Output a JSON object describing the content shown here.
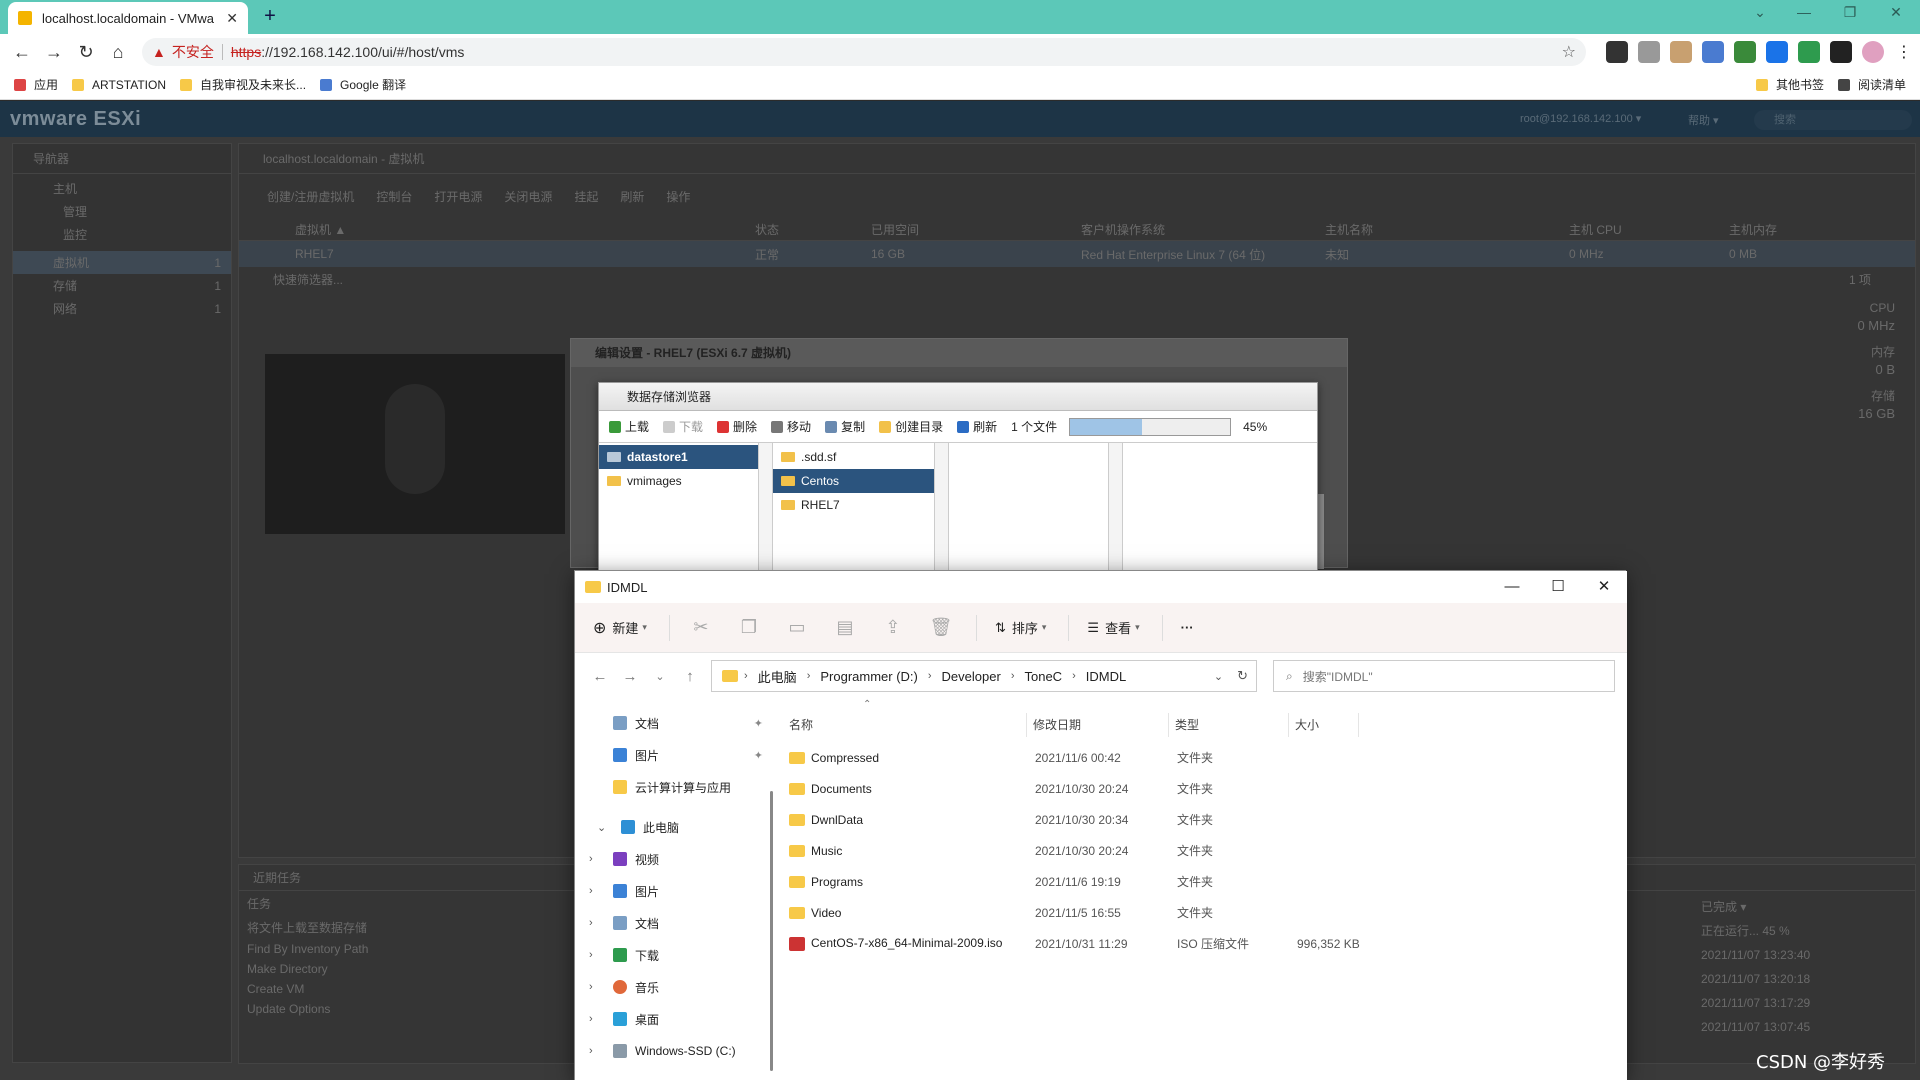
{
  "browser": {
    "tab_title": "localhost.localdomain - VMwa",
    "url_warning": "不安全",
    "url_scheme": "https",
    "url_rest": "://192.168.142.100/ui/#/host/vms",
    "bookmarks": [
      "应用",
      "ARTSTATION",
      "自我审视及未来长...",
      "Google 翻译"
    ],
    "bookmarks_right": [
      "其他书签",
      "阅读清单"
    ]
  },
  "esxi": {
    "logo": "vmware ESXi",
    "user": "root@192.168.142.100 ▾",
    "help": "帮助 ▾",
    "search_placeholder": "搜索",
    "navigator_title": "导航器",
    "nav_items": [
      "主机",
      "管理",
      "监控",
      "虚拟机",
      "存储",
      "网络"
    ],
    "nav_counts": [
      "1",
      "1",
      "1"
    ],
    "breadcrumb": "localhost.localdomain - 虚拟机",
    "actions": [
      "创建/注册虚拟机",
      "控制台",
      "打开电源",
      "关闭电源",
      "挂起",
      "刷新",
      "操作"
    ],
    "columns": [
      "虚拟机 ▲",
      "状态",
      "已用空间",
      "客户机操作系统",
      "主机名称",
      "主机 CPU",
      "主机内存"
    ],
    "row": [
      "RHEL7",
      "正常",
      "16 GB",
      "Red Hat Enterprise Linux 7 (64 位)",
      "未知",
      "0 MHz",
      "0 MB"
    ],
    "filter_placeholder": "快速筛选器...",
    "count": "1 项",
    "side_stats": [
      {
        "label": "CPU",
        "value": "0 MHz"
      },
      {
        "label": "内存",
        "value": "0 B"
      },
      {
        "label": "存储",
        "value": "16 GB"
      }
    ],
    "recent_tasks_title": "近期任务",
    "tasks_header": "任务",
    "tasks": [
      "将文件上载至数据存储",
      "Find By Inventory Path",
      "Make Directory",
      "Create VM",
      "Update Options"
    ],
    "tasks_completed_header": "已完成 ▾",
    "tasks_status": [
      "正在运行... 45 %",
      "2021/11/07 13:23:40",
      "2021/11/07 13:20:18",
      "2021/11/07 13:17:29",
      "2021/11/07 13:07:45"
    ]
  },
  "edit_dialog": {
    "title": "编辑设置 - RHEL7 (ESXi 6.7 虚拟机)"
  },
  "datastore_browser": {
    "title": "数据存储浏览器",
    "tools": [
      "上载",
      "下载",
      "删除",
      "移动",
      "复制",
      "创建目录",
      "刷新"
    ],
    "file_count": "1 个文件",
    "progress": 0.45,
    "progress_text": "45%",
    "datastores": [
      "datastore1",
      "vmimages"
    ],
    "folders": [
      ".sdd.sf",
      "Centos",
      "RHEL7"
    ]
  },
  "explorer": {
    "title": "IDMDL",
    "cmd": {
      "new": "新建",
      "sort": "排序",
      "view": "查看",
      "more": "···"
    },
    "path": [
      "此电脑",
      "Programmer (D:)",
      "Developer",
      "ToneC",
      "IDMDL"
    ],
    "search_placeholder": "搜索\"IDMDL\"",
    "nav_pinned": [
      "文档",
      "图片",
      "云计算计算与应用"
    ],
    "nav_pc": "此电脑",
    "nav_pc_items": [
      "视频",
      "图片",
      "文档",
      "下载",
      "音乐",
      "桌面",
      "Windows-SSD (C:)"
    ],
    "columns": [
      "名称",
      "修改日期",
      "类型",
      "大小"
    ],
    "files": [
      {
        "name": "Compressed",
        "date": "2021/11/6 00:42",
        "type": "文件夹",
        "size": "",
        "icon": "folder-icon"
      },
      {
        "name": "Documents",
        "date": "2021/10/30 20:24",
        "type": "文件夹",
        "size": "",
        "icon": "folder-icon"
      },
      {
        "name": "DwnlData",
        "date": "2021/10/30 20:34",
        "type": "文件夹",
        "size": "",
        "icon": "folder-icon"
      },
      {
        "name": "Music",
        "date": "2021/10/30 20:24",
        "type": "文件夹",
        "size": "",
        "icon": "folder-icon"
      },
      {
        "name": "Programs",
        "date": "2021/11/6 19:19",
        "type": "文件夹",
        "size": "",
        "icon": "folder-icon"
      },
      {
        "name": "Video",
        "date": "2021/11/5 16:55",
        "type": "文件夹",
        "size": "",
        "icon": "folder-icon"
      },
      {
        "name": "CentOS-7-x86_64-Minimal-2009.iso",
        "date": "2021/10/31 11:29",
        "type": "ISO 压缩文件",
        "size": "996,352 KB",
        "icon": "iso-file-icon"
      }
    ]
  },
  "watermark": "CSDN @李好秀"
}
